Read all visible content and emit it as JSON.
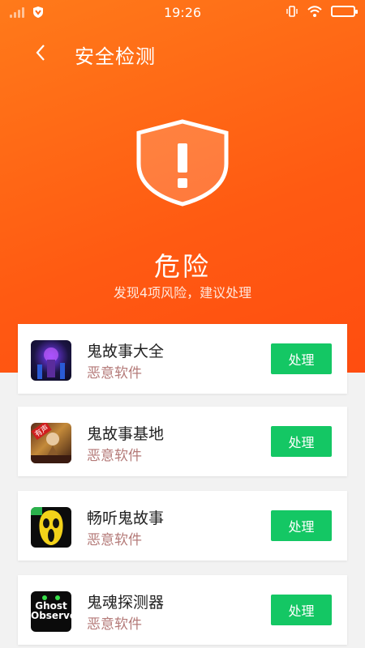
{
  "status_bar": {
    "time": "19:26"
  },
  "header": {
    "back_icon": "chevron-left-icon",
    "title": "安全检测"
  },
  "summary": {
    "shield_icon": "shield-alert-icon",
    "status": "危险",
    "description": "发现4项风险，建议处理"
  },
  "apps": [
    {
      "name": "鬼故事大全",
      "type": "恶意软件",
      "action": "处理",
      "icon": "app-icon-ghost-stories"
    },
    {
      "name": "鬼故事基地",
      "type": "恶意软件",
      "action": "处理",
      "icon": "app-icon-ghost-base",
      "badge": "有声"
    },
    {
      "name": "畅听鬼故事",
      "type": "恶意软件",
      "action": "处理",
      "icon": "app-icon-scream-mask"
    },
    {
      "name": "鬼魂探测器",
      "type": "恶意软件",
      "action": "处理",
      "icon": "app-icon-ghost-observer",
      "icon_text": "Ghost Observer"
    }
  ],
  "colors": {
    "hero": "#ff5a12",
    "button": "#14c764",
    "warning_text": "#b47a78"
  }
}
